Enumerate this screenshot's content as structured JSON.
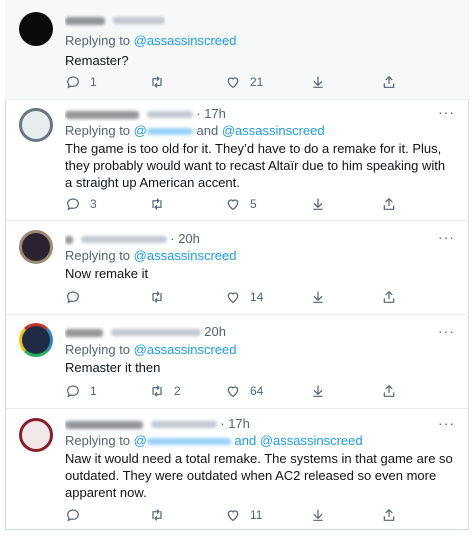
{
  "replying_label": "Replying to",
  "and_label": "and",
  "more_icon": "more-horizontal-icon",
  "icons": {
    "reply": "reply-icon",
    "retweet": "retweet-icon",
    "like": "heart-icon",
    "download": "download-icon",
    "share": "share-icon"
  },
  "tweets": [
    {
      "time": "",
      "mention_main": "@assassinscreed",
      "text": "Remaster?",
      "replies": "1",
      "retweets": "",
      "likes": "21"
    },
    {
      "time": "· 17h",
      "mention_main": "@assassinscreed",
      "text": "The game is too old for it. They’d have to do a remake for it. Plus, they probably would want to recast Altaïr due to him speaking with a straight up American accent.",
      "replies": "3",
      "retweets": "",
      "likes": "5"
    },
    {
      "time": "· 20h",
      "mention_main": "@assassinscreed",
      "text": "Now remake it",
      "replies": "",
      "retweets": "",
      "likes": "14"
    },
    {
      "time": "20h",
      "mention_main": "@assassinscreed",
      "text": "Remaster it then",
      "replies": "1",
      "retweets": "2",
      "likes": "64"
    },
    {
      "time": "· 17h",
      "mention_main": "@assassinscreed",
      "text": "Naw it would need a total remake. The systems in that game are so outdated. They were outdated when AC2 released so even more apparent now.",
      "replies": "",
      "retweets": "",
      "likes": "11"
    }
  ]
}
